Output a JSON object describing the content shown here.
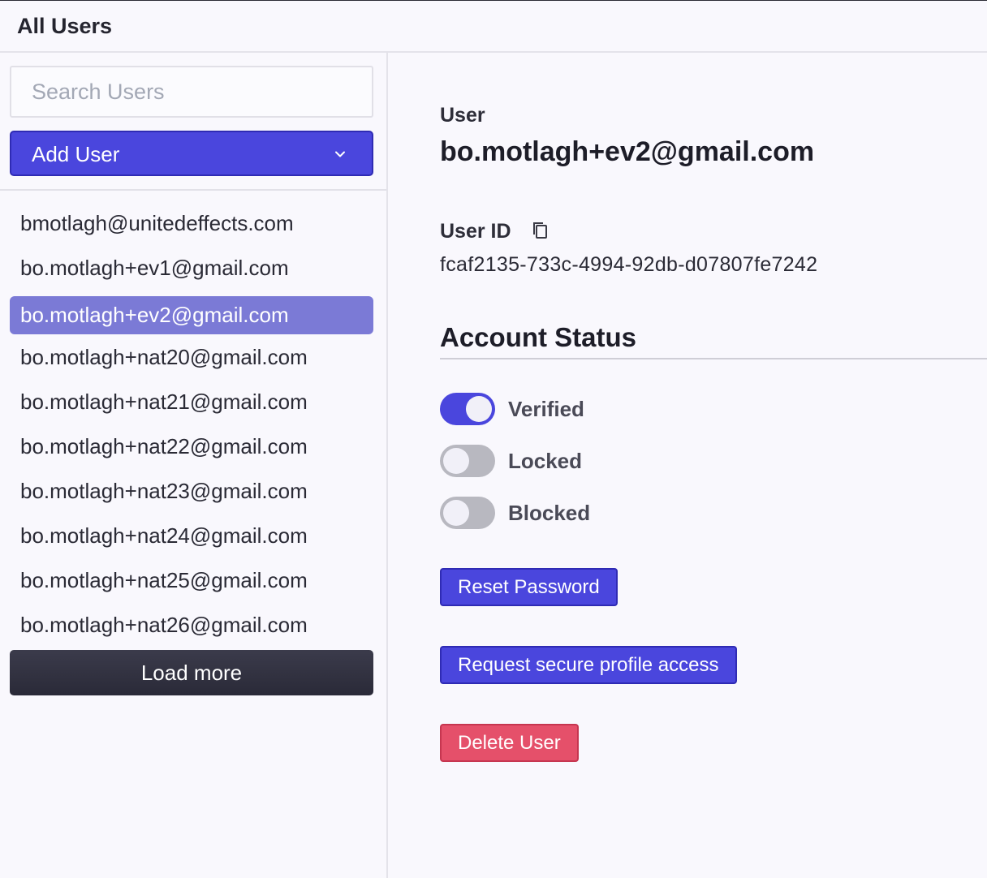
{
  "header": {
    "title": "All Users"
  },
  "sidebar": {
    "search": {
      "placeholder": "Search Users",
      "value": ""
    },
    "add_user_label": "Add User",
    "users": [
      {
        "email": "bmotlagh@unitedeffects.com",
        "selected": false
      },
      {
        "email": "bo.motlagh+ev1@gmail.com",
        "selected": false
      },
      {
        "email": "bo.motlagh+ev2@gmail.com",
        "selected": true
      },
      {
        "email": "bo.motlagh+nat20@gmail.com",
        "selected": false
      },
      {
        "email": "bo.motlagh+nat21@gmail.com",
        "selected": false
      },
      {
        "email": "bo.motlagh+nat22@gmail.com",
        "selected": false
      },
      {
        "email": "bo.motlagh+nat23@gmail.com",
        "selected": false
      },
      {
        "email": "bo.motlagh+nat24@gmail.com",
        "selected": false
      },
      {
        "email": "bo.motlagh+nat25@gmail.com",
        "selected": false
      },
      {
        "email": "bo.motlagh+nat26@gmail.com",
        "selected": false
      }
    ],
    "load_more_label": "Load more"
  },
  "detail": {
    "user_label": "User",
    "user_email": "bo.motlagh+ev2@gmail.com",
    "user_id_label": "User ID",
    "user_id": "fcaf2135-733c-4994-92db-d07807fe7242",
    "account_status_title": "Account Status",
    "toggles": [
      {
        "label": "Verified",
        "on": true
      },
      {
        "label": "Locked",
        "on": false
      },
      {
        "label": "Blocked",
        "on": false
      }
    ],
    "buttons": {
      "reset_password": "Reset Password",
      "request_access": "Request secure profile access",
      "delete_user": "Delete User"
    }
  },
  "colors": {
    "accent": "#4a46dd",
    "selected_row": "#7b7ad6",
    "danger": "#e5506a",
    "dark_button": "#2f2f3d",
    "background": "#f9f8fd"
  }
}
